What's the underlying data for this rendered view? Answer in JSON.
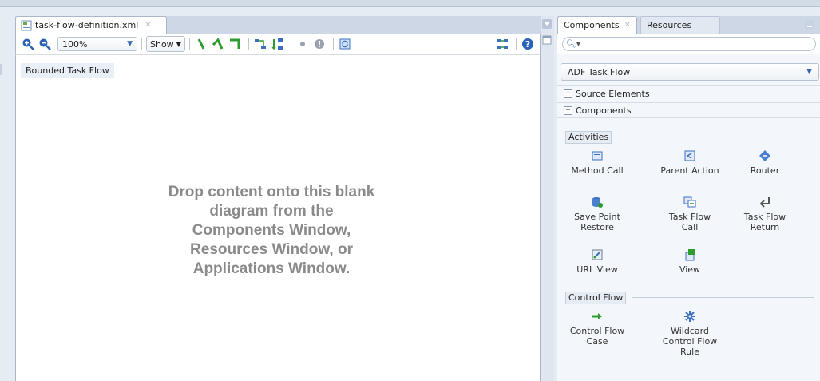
{
  "editor": {
    "tab_title": "task-flow-definition.xml",
    "zoom_value": "100%",
    "show_label": "Show",
    "diagram_label": "Bounded Task Flow",
    "drop_message": "Drop content onto this blank\ndiagram from the\nComponents Window,\nResources Window, or\nApplications Window."
  },
  "panel": {
    "tabs": [
      {
        "label": "Components"
      },
      {
        "label": "Resources"
      }
    ],
    "search_placeholder": "",
    "category": "ADF Task Flow",
    "sections": [
      {
        "label": "Source Elements",
        "expanded": false
      },
      {
        "label": "Components",
        "expanded": true
      }
    ],
    "activities_title": "Activities",
    "activities": [
      {
        "label": "Method Call",
        "icon": "method-call-icon"
      },
      {
        "label": "Parent Action",
        "icon": "parent-action-icon"
      },
      {
        "label": "Router",
        "icon": "router-icon"
      },
      {
        "label": "Save Point\nRestore",
        "icon": "save-point-restore-icon"
      },
      {
        "label": "Task Flow\nCall",
        "icon": "task-flow-call-icon"
      },
      {
        "label": "Task Flow\nReturn",
        "icon": "task-flow-return-icon"
      },
      {
        "label": "URL View",
        "icon": "url-view-icon"
      },
      {
        "label": "View",
        "icon": "view-icon"
      }
    ],
    "control_flow_title": "Control Flow",
    "control_flows": [
      {
        "label": "Control Flow\nCase",
        "icon": "control-flow-case-icon"
      },
      {
        "label": "Wildcard\nControl Flow\nRule",
        "icon": "wildcard-control-flow-rule-icon"
      }
    ]
  }
}
